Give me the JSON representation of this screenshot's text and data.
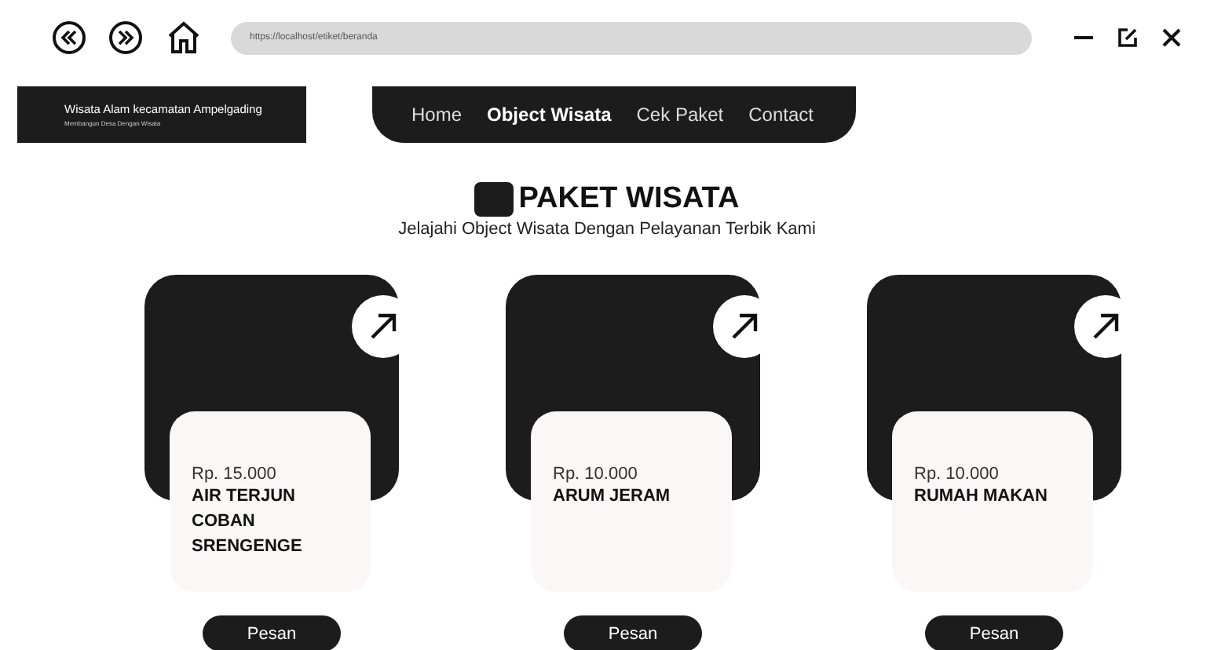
{
  "browser": {
    "url": "https://localhost/etiket/beranda"
  },
  "brand": {
    "title": "Wisata Alam kecamatan Ampelgading",
    "subtitle": "Membangun Desa Dengan Wisata"
  },
  "nav": [
    {
      "label": "Home",
      "selected": false
    },
    {
      "label": "Object Wisata",
      "selected": true
    },
    {
      "label": "Cek Paket",
      "selected": false
    },
    {
      "label": "Contact",
      "selected": false
    }
  ],
  "heading": {
    "title": "PAKET WISATA",
    "subtitle": "Jelajahi Object Wisata Dengan Pelayanan Terbik Kami"
  },
  "packages": [
    {
      "price": "Rp. 15.000",
      "name": "AIR TERJUN COBAN SRENGENGE",
      "button": "Pesan"
    },
    {
      "price": "Rp. 10.000",
      "name": "ARUM JERAM",
      "button": "Pesan"
    },
    {
      "price": "Rp. 10.000",
      "name": "RUMAH MAKAN",
      "button": "Pesan"
    }
  ]
}
